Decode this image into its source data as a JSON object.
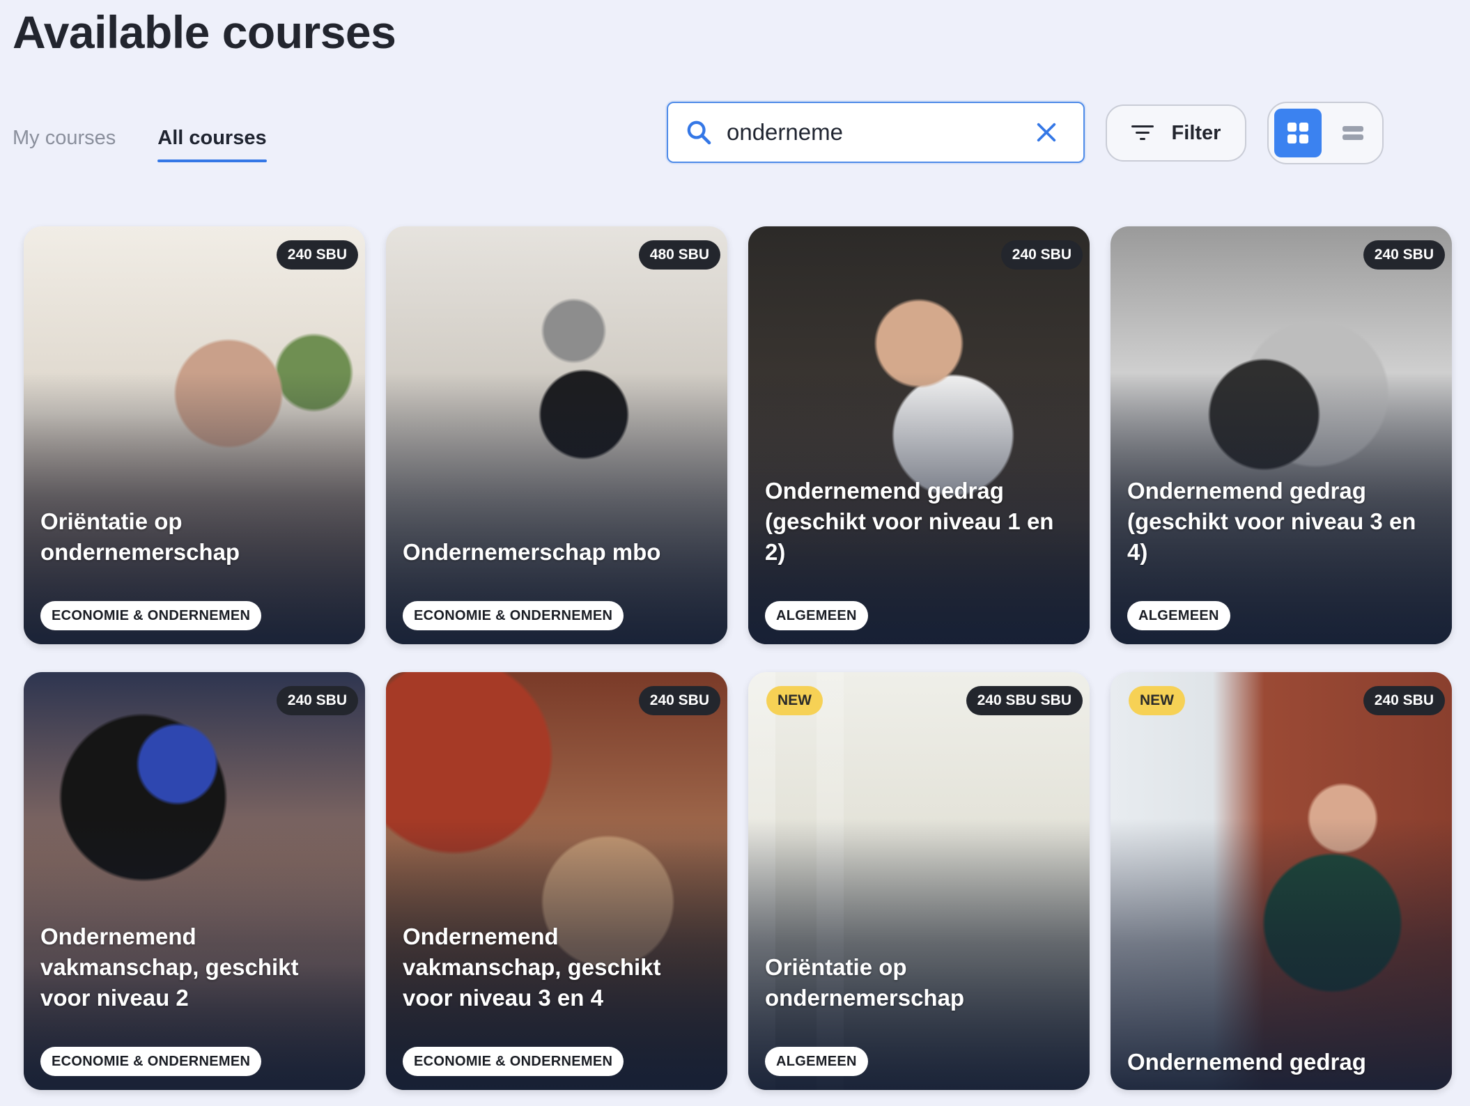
{
  "page": {
    "title": "Available courses"
  },
  "tabs": [
    {
      "label": "My courses",
      "active": false
    },
    {
      "label": "All courses",
      "active": true
    }
  ],
  "search": {
    "value": "onderneme",
    "placeholder": ""
  },
  "filter": {
    "label": "Filter"
  },
  "view_toggle": {
    "active": "grid",
    "options": [
      "grid-icon",
      "list-icon"
    ]
  },
  "colors": {
    "accent": "#3477e6",
    "new_badge": "#f6d155",
    "sbu_badge": "#23262d"
  },
  "courses": [
    {
      "title": "Oriëntatie op ondernemerschap",
      "sbu": "240 SBU",
      "category": "ECONOMIE & ONDERNEMEN",
      "new": ""
    },
    {
      "title": "Ondernemerschap mbo",
      "sbu": "480 SBU",
      "category": "ECONOMIE & ONDERNEMEN",
      "new": ""
    },
    {
      "title": "Ondernemend gedrag (geschikt voor niveau 1 en 2)",
      "sbu": "240 SBU",
      "category": "ALGEMEEN",
      "new": ""
    },
    {
      "title": "Ondernemend gedrag (geschikt voor niveau 3 en 4)",
      "sbu": "240 SBU",
      "category": "ALGEMEEN",
      "new": ""
    },
    {
      "title": "Ondernemend vakmanschap, geschikt voor niveau 2",
      "sbu": "240 SBU",
      "category": "ECONOMIE & ONDERNEMEN",
      "new": ""
    },
    {
      "title": "Ondernemend vakmanschap, geschikt voor niveau 3 en 4",
      "sbu": "240 SBU",
      "category": "ECONOMIE & ONDERNEMEN",
      "new": ""
    },
    {
      "title": "Oriëntatie op ondernemerschap",
      "sbu": "240 SBU SBU",
      "category": "ALGEMEEN",
      "new": "NEW"
    },
    {
      "title": "Ondernemend gedrag",
      "sbu": "240 SBU",
      "category": "",
      "new": "NEW"
    }
  ]
}
